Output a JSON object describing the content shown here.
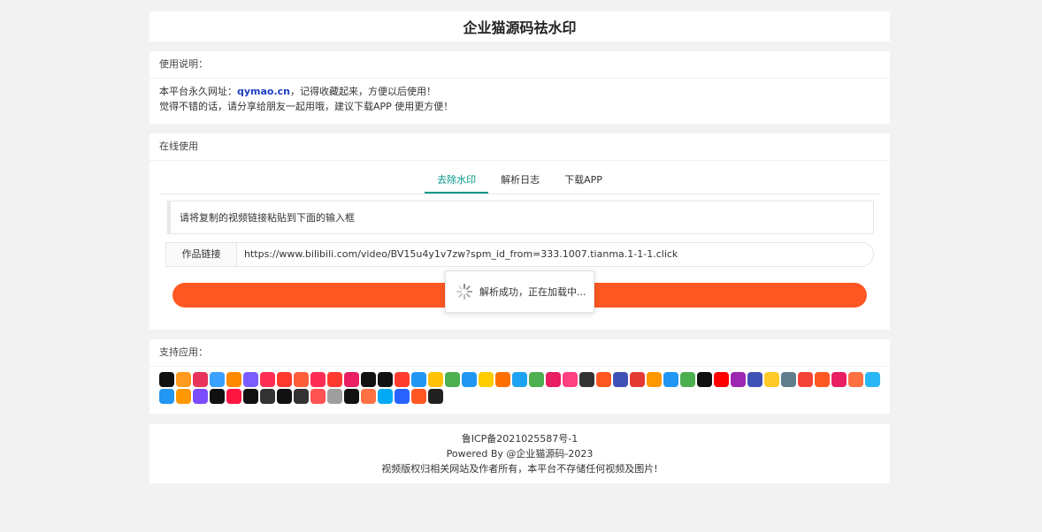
{
  "header": {
    "title": "企业猫源码祛水印"
  },
  "notice": {
    "heading": "使用说明：",
    "line1_prefix": "本平台永久网址：",
    "line1_link": "qymao.cn",
    "line1_suffix": "，记得收藏起来，方便以后使用！",
    "line2": "觉得不错的话，请分享给朋友一起用哦，建议下载APP 使用更方便！"
  },
  "online": {
    "heading": "在线使用",
    "tabs": [
      {
        "label": "去除水印",
        "active": true
      },
      {
        "label": "解析日志",
        "active": false
      },
      {
        "label": "下载APP",
        "active": false
      }
    ],
    "hint": "请将复制的视频链接粘贴到下面的输入框",
    "input_label": "作品链接",
    "input_value": "https://www.bilibili.com/video/BV15u4y1v7zw?spm_id_from=333.1007.tianma.1-1-1.click",
    "button_color": "#ff5722"
  },
  "loading": {
    "text": "解析成功，正在加载中..."
  },
  "apps": {
    "heading": "支持应用：",
    "icon_colors": [
      "#111111",
      "#ff9a1e",
      "#e8345a",
      "#3aa0ff",
      "#ff8a00",
      "#7a5cff",
      "#ff2d55",
      "#ff3b30",
      "#ff5e3a",
      "#ff2d55",
      "#ff3b30",
      "#e91e63",
      "#111111",
      "#111111",
      "#ff3b30",
      "#2196f3",
      "#ffc107",
      "#4caf50",
      "#2196f3",
      "#ffcc00",
      "#ff6f00",
      "#1da1f2",
      "#4caf50",
      "#e91e63",
      "#ff4081",
      "#333333",
      "#ff5722",
      "#3f51b5",
      "#e53935",
      "#ff9800",
      "#2196f3",
      "#4caf50",
      "#111111",
      "#ff0000",
      "#9c27b0",
      "#3f51b5",
      "#ffca28",
      "#607d8b",
      "#f44336",
      "#ff5722",
      "#e91e63",
      "#ff7043",
      "#29b6f6",
      "#2196f3",
      "#ff9800",
      "#7c4dff",
      "#111111",
      "#ff1744",
      "#111111",
      "#333333",
      "#111111",
      "#333333",
      "#ff5252",
      "#9e9e9e",
      "#111111",
      "#ff7043",
      "#03a9f4",
      "#2962ff",
      "#ff5722",
      "#212121"
    ]
  },
  "footer": {
    "icp": "鲁ICP备2021025587号-1",
    "powered": "Powered By @企业猫源码-2023",
    "disclaimer": "视频版权归相关网站及作者所有，本平台不存储任何视频及图片!"
  }
}
